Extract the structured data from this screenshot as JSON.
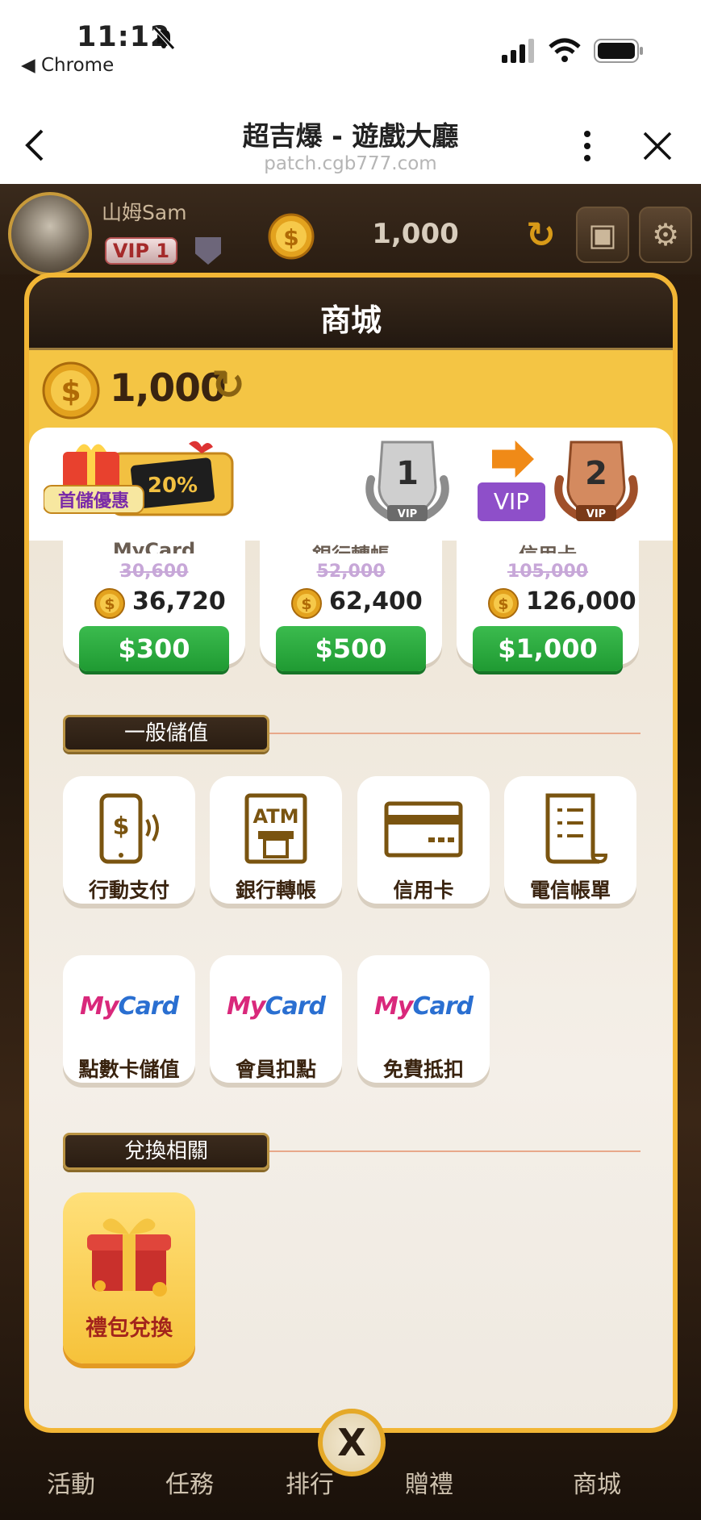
{
  "status_bar": {
    "time": "11:12",
    "back_app": "◀ Chrome"
  },
  "browser": {
    "title": "超吉爆 - 遊戲大廳",
    "url": "patch.cgb777.com"
  },
  "player": {
    "name": "山姆Sam",
    "vip": "VIP 1",
    "coins": "1,000"
  },
  "shop": {
    "title": "商城",
    "balance": "1,000",
    "promo": {
      "label": "首儲優惠",
      "discount": "20%",
      "vip_from": "1",
      "vip_to": "2",
      "vip_label": "VIP",
      "badge_text": "VIP"
    },
    "packages": [
      {
        "method": "MyCard",
        "original": "30,600",
        "coins": "36,720",
        "price": "$300"
      },
      {
        "method": "銀行轉帳",
        "original": "52,000",
        "coins": "62,400",
        "price": "$500"
      },
      {
        "method": "信用卡",
        "original": "105,000",
        "coins": "126,000",
        "price": "$1,000"
      }
    ],
    "general_section": "一般儲值",
    "general_tiles": [
      "行動支付",
      "銀行轉帳",
      "信用卡",
      "電信帳單"
    ],
    "mycard_tiles": [
      "點數卡儲值",
      "會員扣點",
      "免費抵扣"
    ],
    "mycard_logo": "MyCard",
    "exchange_section": "兌換相關",
    "exchange_tile": "禮包兌換"
  },
  "bottom_nav": [
    "活動",
    "任務",
    "排行",
    "贈禮",
    "商城"
  ],
  "close_label": "X",
  "colors": {
    "gold": "#f2b635",
    "green": "#1f9a32",
    "dark": "#2a1d12",
    "purple": "#8e4fc9"
  }
}
